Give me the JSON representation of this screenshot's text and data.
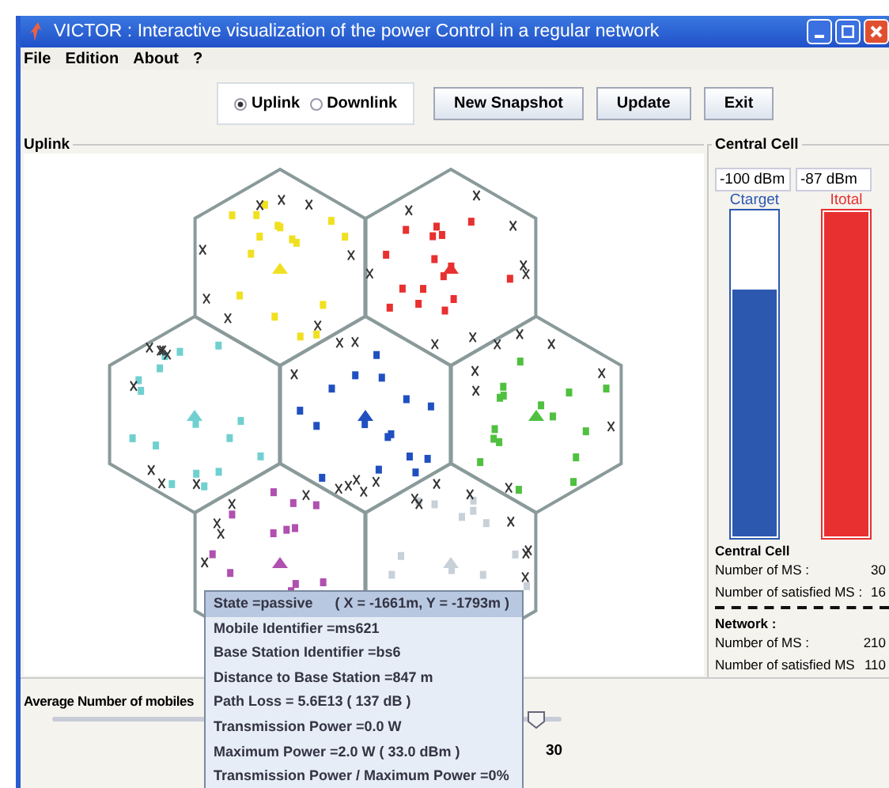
{
  "window": {
    "title": "VICTOR : Interactive visualization of the power Control in a regular network"
  },
  "menu": [
    "File",
    "Edition",
    "About",
    "?"
  ],
  "link_modes": [
    {
      "label": "Uplink",
      "selected": true
    },
    {
      "label": "Downlink",
      "selected": false
    }
  ],
  "buttons": [
    "New Snapshot",
    "Update",
    "Exit"
  ],
  "map_panel": {
    "title": "Uplink",
    "cells": [
      {
        "color": "#f0e020"
      },
      {
        "color": "#e83030"
      },
      {
        "color": "#70d0d0"
      },
      {
        "color": "#2050c0"
      },
      {
        "color": "#50c040"
      },
      {
        "color": "#b050b0"
      },
      {
        "color": "#c8d0d8"
      }
    ]
  },
  "central_cell_panel": {
    "title": "Central Cell",
    "fields": [
      "-100 dBm",
      "-87 dBm"
    ],
    "bars": [
      {
        "label": "Ctarget",
        "level": 0.76,
        "color": "#2c58b0"
      },
      {
        "label": "Itotal",
        "level": 1,
        "color": "#e83030"
      }
    ],
    "central_cell": {
      "heading": "Central Cell",
      "rows": [
        {
          "label": "Number of MS :",
          "value": "30"
        },
        {
          "label": "Number of satisfied MS :",
          "value": "16"
        }
      ]
    },
    "network": {
      "heading": "Network :",
      "rows": [
        {
          "label": "Number of MS :",
          "value": "210"
        },
        {
          "label": "Number of satisfied MS",
          "value": "110"
        }
      ]
    }
  },
  "bottom": {
    "label": "Average Number of mobiles",
    "slider": {
      "level": 0.95
    },
    "value": "30"
  },
  "tooltip": {
    "state": "State =passive",
    "position": "( X = -1661m, Y = -1793m )",
    "lines": [
      "Mobile Identifier =ms621",
      "Base Station Identifier =bs6",
      "Distance to Base Station =847 m",
      "Path Loss = 5.6E13  ( 137 dB )",
      "Transmission Power =0.0 W",
      "Maximum Power =2.0 W   ( 33.0 dBm )",
      "Transmission Power / Maximum Power =0%"
    ]
  }
}
